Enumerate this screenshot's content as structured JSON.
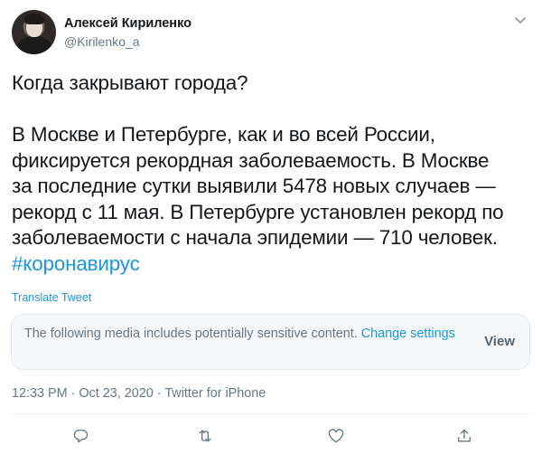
{
  "author": {
    "display_name": "Алексей Кириленко",
    "handle": "@Kirilenko_a"
  },
  "tweet": {
    "title_line": "Когда закрывают города?",
    "lines": [
      "В Москве и Петербурге, как и во всей России,",
      "фиксируется рекордная заболеваемость. В Москве",
      "за последние сутки выявили 5478 новых случаев —",
      "рекорд с 11 мая. В Петербурге установлен рекорд по",
      "заболеваемости с начала эпидемии — 710 человек."
    ],
    "hashtag": "#коронавирус",
    "translate_label": "Translate Tweet"
  },
  "notice": {
    "text": "The following media includes potentially sensitive content. ",
    "change_link": "Change settings",
    "view_label": "View"
  },
  "meta": {
    "timestamp": "12:33 PM · Oct 23, 2020 · Twitter for iPhone"
  },
  "actions": [
    {
      "name": "reply-icon"
    },
    {
      "name": "retweet-icon"
    },
    {
      "name": "like-icon"
    },
    {
      "name": "share-icon"
    }
  ],
  "colors": {
    "accent": "#1b95e0",
    "muted": "#657786",
    "text": "#14171a"
  }
}
